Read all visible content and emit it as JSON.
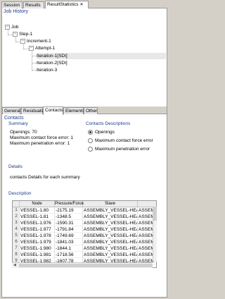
{
  "tabs": [
    {
      "label": "Session"
    },
    {
      "label": "Results"
    },
    {
      "label": "ResultStatistics",
      "close": "✕"
    }
  ],
  "job_history": {
    "title": "Job History",
    "tree": [
      {
        "label": "Job",
        "toggle": "−"
      },
      {
        "label": "Step-1",
        "toggle": "−"
      },
      {
        "label": "Increment-1",
        "toggle": "−"
      },
      {
        "label": "Attempt-1",
        "toggle": "−"
      },
      {
        "label": "Iteration-1[SDI]"
      },
      {
        "label": "Iteration-2[SDI]"
      },
      {
        "label": "Iteration-3"
      }
    ]
  },
  "sub_tabs": [
    "General",
    "Residuals",
    "Contacts",
    "Elements",
    "Other"
  ],
  "contacts": {
    "title": "Contacts",
    "summary_title": "Summary",
    "openings": "Openings: 70",
    "max_contact_force": "Maximum contact force error: 1",
    "max_penetration": "Maximum penetration error: 1",
    "descriptions_title": "Contacts Descriptions",
    "options": [
      "Openings",
      "Maximum contact force error",
      "Maximum penetration error"
    ],
    "selected_option": "Openings",
    "details_title": "Details",
    "details_text": "contacts Details for each summary",
    "description_title": "Description"
  },
  "table": {
    "columns": [
      "",
      "Node",
      "Pressure/Force",
      "Slave",
      ""
    ],
    "rows": [
      [
        "1",
        "VESSEL-1.80",
        "-2175.19",
        "ASSEMBLY_VESSEL-HEAD",
        "ASSEM"
      ],
      [
        "2",
        "VESSEL-1.81",
        "-1348.5",
        "ASSEMBLY_VESSEL-HEAD",
        "ASSEM"
      ],
      [
        "3",
        "VESSEL-1.976",
        "-1590.31",
        "ASSEMBLY_VESSEL-HEAD",
        "ASSEM"
      ],
      [
        "4",
        "VESSEL-1.977",
        "-1791.84",
        "ASSEMBLY_VESSEL-HEAD",
        "ASSEM"
      ],
      [
        "5",
        "VESSEL-1.978",
        "-1749.69",
        "ASSEMBLY_VESSEL-HEAD",
        "ASSEM"
      ],
      [
        "6",
        "VESSEL-1.979",
        "-1841.03",
        "ASSEMBLY_VESSEL-HEAD",
        "ASSEM"
      ],
      [
        "7",
        "VESSEL-1.980",
        "-1844.1",
        "ASSEMBLY_VESSEL-HEAD",
        "ASSEM"
      ],
      [
        "8",
        "VESSEL-1.981",
        "-1718.56",
        "ASSEMBLY_VESSEL-HEAD",
        "ASSEM"
      ],
      [
        "9",
        "VESSEL-1.982",
        "-1607.78",
        "ASSEMBLY_VESSEL-HEAD",
        "ASSEM"
      ]
    ]
  },
  "colors": {
    "section_title": "#1d3c86",
    "panel_bg": "#d4d0c8"
  }
}
